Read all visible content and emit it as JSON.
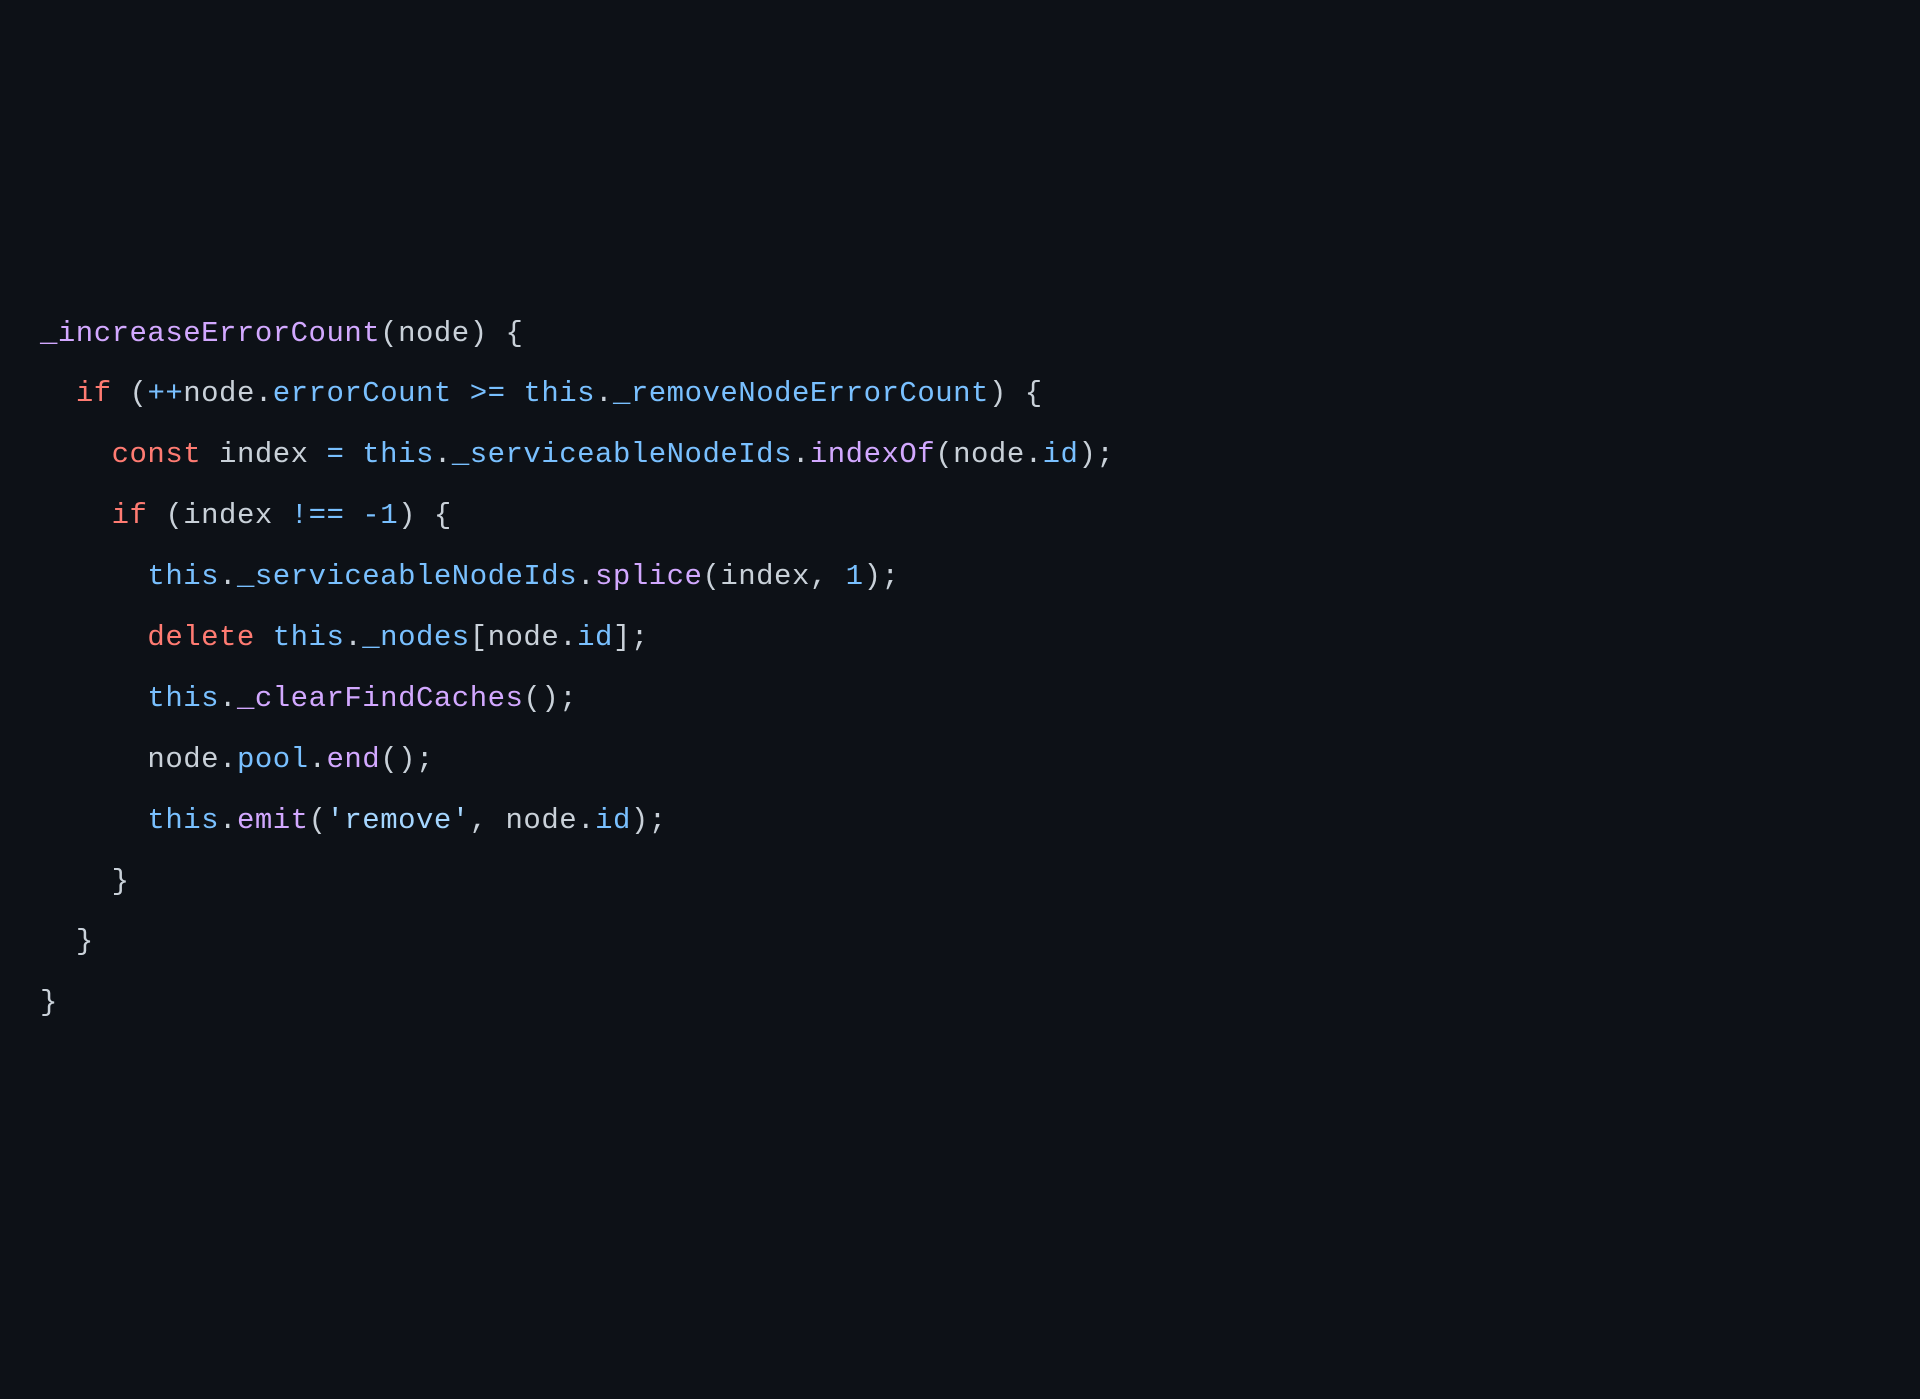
{
  "code": {
    "line1": {
      "fn_name": "_increaseErrorCount",
      "param": "node"
    },
    "line2": {
      "kw_if": "if",
      "op_inc": "++",
      "node": "node",
      "prop_errorCount": "errorCount",
      "op_gte": ">=",
      "this": "this",
      "prop_removeNodeErrorCount": "_removeNodeErrorCount"
    },
    "line3": {
      "kw_const": "const",
      "ident_index": "index",
      "op_eq": "=",
      "this": "this",
      "prop_serviceableNodeIds": "_serviceableNodeIds",
      "method_indexOf": "indexOf",
      "node": "node",
      "prop_id": "id"
    },
    "line4": {
      "kw_if": "if",
      "ident_index": "index",
      "op_neq": "!==",
      "neg": "-",
      "num_1": "1"
    },
    "line5": {
      "this": "this",
      "prop_serviceableNodeIds": "_serviceableNodeIds",
      "method_splice": "splice",
      "ident_index": "index",
      "num_1": "1"
    },
    "line6": {
      "kw_delete": "delete",
      "this": "this",
      "prop_nodes": "_nodes",
      "node": "node",
      "prop_id": "id"
    },
    "line7": {
      "this": "this",
      "method_clearFindCaches": "_clearFindCaches"
    },
    "line8": {
      "node": "node",
      "prop_pool": "pool",
      "method_end": "end"
    },
    "line9": {
      "this": "this",
      "method_emit": "emit",
      "str_remove": "'remove'",
      "node": "node",
      "prop_id": "id"
    }
  }
}
